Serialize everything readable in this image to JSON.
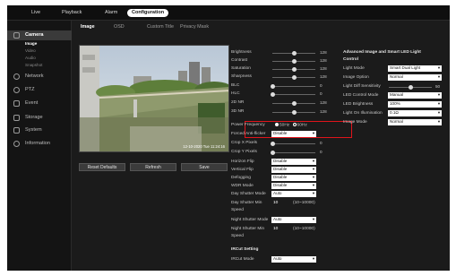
{
  "nav": [
    "Live",
    "Playback",
    "Alarm",
    "Configuration"
  ],
  "nav_active": 3,
  "sidebar": {
    "camera": "Camera",
    "sub": [
      "Image",
      "Video",
      "Audio",
      "Snapshot"
    ],
    "network": "Network",
    "ptz": "PTZ",
    "event": "Event",
    "storage": "Storage",
    "system": "System",
    "information": "Information"
  },
  "tabs": [
    "Image",
    "OSD",
    "Custom Title",
    "Privacy Mask"
  ],
  "preview": {
    "timestamp": "12-10-2020 Tue 11:24:16"
  },
  "buttons": {
    "reset": "Reset Defaults",
    "refresh": "Refresh",
    "save": "Save"
  },
  "image": {
    "brightness": {
      "label": "Brightness",
      "value": "128",
      "level": 0.5
    },
    "contrast": {
      "label": "Contrast",
      "value": "128",
      "level": 0.5
    },
    "saturation": {
      "label": "Saturation",
      "value": "128",
      "level": 0.5
    },
    "sharpness": {
      "label": "Sharpness",
      "value": "128",
      "level": 0.5
    },
    "blc": {
      "label": "BLC",
      "value": "0",
      "level": 0
    },
    "hlc": {
      "label": "HLC",
      "value": "0",
      "level": 0
    },
    "dnr2": {
      "label": "2D NR",
      "value": "128",
      "level": 0.5
    },
    "dnr3": {
      "label": "3D NR",
      "value": "128",
      "level": 0.5
    }
  },
  "power_frequency": {
    "label": "Power Frequency",
    "opt1": "50Hz",
    "opt2": "60Hz"
  },
  "anti_flicker": {
    "label": "Forced Anti-flicker",
    "value": "Disable"
  },
  "crop_x": {
    "label": "Crop X Pixels",
    "value": "0"
  },
  "crop_y": {
    "label": "Crop Y Pixels",
    "value": "0"
  },
  "flip": [
    {
      "label": "Horizon Flip",
      "value": "Disable"
    },
    {
      "label": "Vertical Flip",
      "value": "Disable"
    },
    {
      "label": "Defogging",
      "value": "Disable"
    },
    {
      "label": "WDR Mode",
      "value": "Disable"
    },
    {
      "label": "Day Shutter Mode",
      "value": "Auto"
    }
  ],
  "day_shutter_speed": {
    "label1": "Day Shutter Min",
    "label2": "Speed",
    "value": "10",
    "range": "(10~10000)"
  },
  "night_shutter_mode": {
    "label": "Night Shutter Mode",
    "value": "Auto"
  },
  "night_shutter_speed": {
    "label1": "Night Shutter Min",
    "label2": "Speed",
    "value": "10",
    "range": "(10~10000)"
  },
  "ircut": {
    "section": "IRCut Setting",
    "label": "IRCut Mode",
    "value": "Auto"
  },
  "advanced": {
    "title1": "Advanced Image and Smart LED Light",
    "title2": "Control",
    "light_mode": {
      "label": "Light Mode",
      "value": "Smart Dual Light"
    },
    "image_option": {
      "label": "Image Option",
      "value": "Normal"
    },
    "light_diff": {
      "label": "Light Diff Sensitivity",
      "value": "50",
      "level": 0.5
    },
    "led_control": {
      "label": "LED Control Mode",
      "value": "Manual"
    },
    "led_brightness": {
      "label": "LED Brightness",
      "value": "100%"
    },
    "light_on_illum": {
      "label": "Light On Illumination",
      "value": "0.1Ω"
    },
    "image_mode": {
      "label": "Image Mode",
      "value": "Normal"
    }
  }
}
